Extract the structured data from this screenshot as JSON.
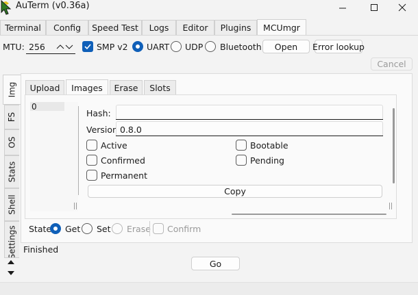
{
  "window": {
    "title": "AuTerm (v0.36a)"
  },
  "main_tabs": [
    {
      "label": "Terminal"
    },
    {
      "label": "Config"
    },
    {
      "label": "Speed Test"
    },
    {
      "label": "Logs"
    },
    {
      "label": "Editor"
    },
    {
      "label": "Plugins"
    },
    {
      "label": "MCUmgr",
      "active": true
    }
  ],
  "toolbar": {
    "mtu_label": "MTU:",
    "mtu_value": "256",
    "smp_label": "SMP v2",
    "smp_checked": true,
    "transports": [
      "UART",
      "UDP",
      "Bluetooth"
    ],
    "selected_transport": "UART",
    "open_label": "Open",
    "error_lookup_label": "Error lookup",
    "cancel_label": "Cancel"
  },
  "side_tabs": [
    {
      "label": "Img",
      "active": true
    },
    {
      "label": "FS"
    },
    {
      "label": "OS"
    },
    {
      "label": "Stats"
    },
    {
      "label": "Shell"
    },
    {
      "label": "Settings"
    }
  ],
  "sub_tabs": [
    {
      "label": "Upload"
    },
    {
      "label": "Images",
      "active": true
    },
    {
      "label": "Erase"
    },
    {
      "label": "Slots"
    }
  ],
  "images": {
    "list_items": [
      "0"
    ],
    "hash_label": "Hash:",
    "hash_value": "",
    "version_label": "Version:",
    "version_value": "0.8.0",
    "flags_left": [
      "Active",
      "Confirmed",
      "Permanent"
    ],
    "flags_right": [
      "Bootable",
      "Pending"
    ],
    "copy_label": "Copy"
  },
  "state": {
    "label": "State:",
    "options": [
      "Get",
      "Set",
      "Erase"
    ],
    "selected": "Get",
    "disabled": [
      "Erase"
    ],
    "confirm_label": "Confirm"
  },
  "status": "Finished",
  "go_label": "Go",
  "colors": {
    "accent": "#0f5fb8"
  }
}
